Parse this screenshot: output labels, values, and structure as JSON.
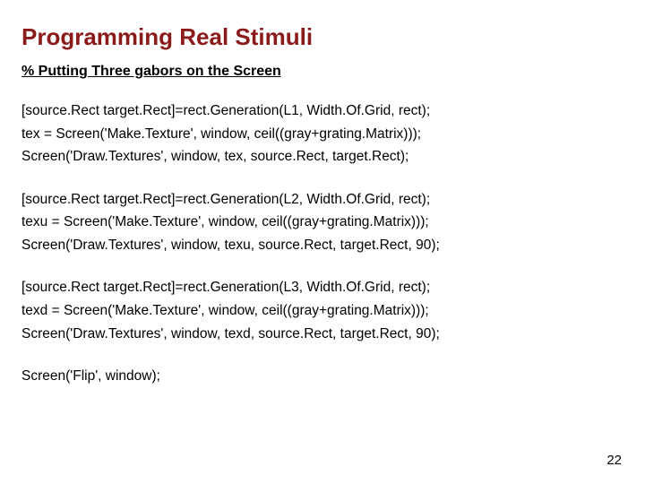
{
  "title": "Programming Real Stimuli",
  "subhead": "% Putting Three gabors on the Screen",
  "blocks": [
    {
      "l1": "[source.Rect  target.Rect]=rect.Generation(L1, Width.Of.Grid, rect);",
      "l2": "tex = Screen('Make.Texture', window, ceil((gray+grating.Matrix)));",
      "l3": "Screen('Draw.Textures',  window,  tex, source.Rect, target.Rect);"
    },
    {
      "l1": "[source.Rect  target.Rect]=rect.Generation(L2, Width.Of.Grid, rect);",
      "l2": "texu = Screen('Make.Texture', window, ceil((gray+grating.Matrix)));",
      "l3": "Screen('Draw.Textures',  window,  texu, source.Rect, target.Rect, 90);"
    },
    {
      "l1": "[source.Rect  target.Rect]=rect.Generation(L3, Width.Of.Grid, rect);",
      "l2": "texd = Screen('Make.Texture', window, ceil((gray+grating.Matrix)));",
      "l3": "Screen('Draw.Textures',  window,  texd, source.Rect, target.Rect, 90);"
    }
  ],
  "flip": "Screen('Flip',  window);",
  "page": "22"
}
